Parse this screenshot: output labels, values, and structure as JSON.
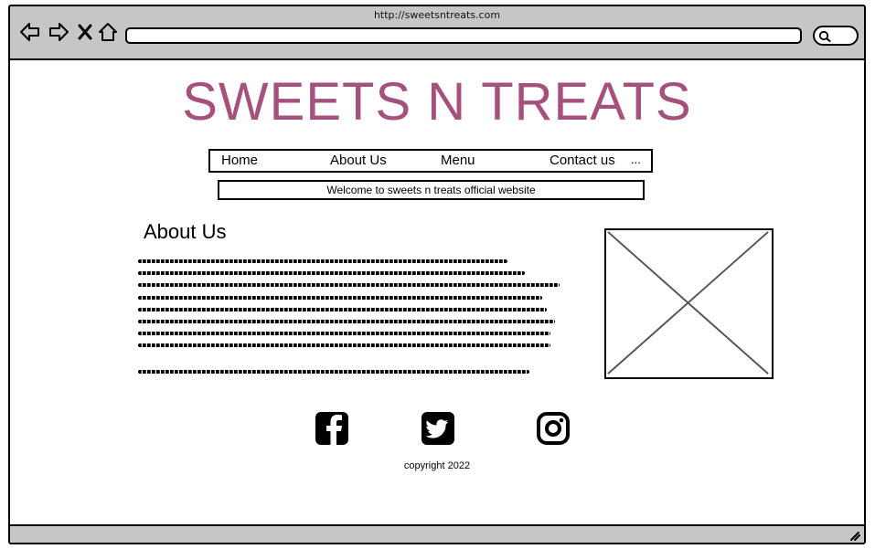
{
  "browser": {
    "url": "http://sweetsntreats.com",
    "icons": [
      "back-icon",
      "forward-icon",
      "close-icon",
      "home-icon",
      "search-icon",
      "resize-grip-icon"
    ]
  },
  "site": {
    "title": "SWEETS N TREATS",
    "title_color": "#a6507c",
    "nav": {
      "items": [
        {
          "label": "Home"
        },
        {
          "label": "About Us"
        },
        {
          "label": "Menu"
        },
        {
          "label": "Contact us"
        }
      ],
      "more": "..."
    },
    "welcome": "Welcome to sweets n treats official website",
    "about": {
      "heading": "About Us"
    },
    "social": [
      "facebook-icon",
      "twitter-icon",
      "instagram-icon"
    ],
    "copyright": "copyright 2022"
  }
}
